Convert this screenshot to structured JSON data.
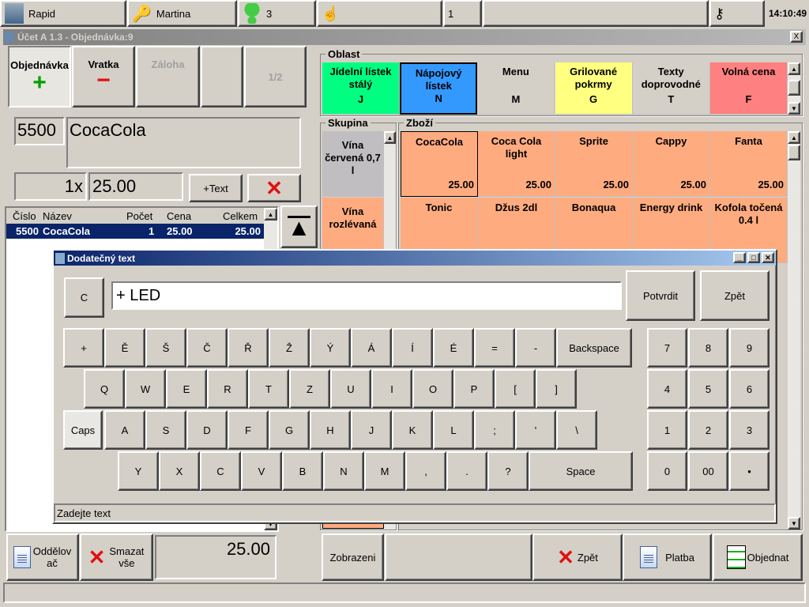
{
  "taskbar": {
    "app": "Rapid",
    "user": "Martina",
    "tables": "3",
    "count": "1",
    "time": "14:10:49"
  },
  "window": {
    "title": "Účet A 1.3 - Objednávka:9",
    "close": "X"
  },
  "mode_buttons": {
    "order": "Objednávka",
    "order_sign": "+",
    "return": "Vratka",
    "return_sign": "−",
    "deposit": "Záloha",
    "page": "1/2"
  },
  "item": {
    "code": "5500",
    "name": "CocaCola",
    "qty": "1x",
    "price": "25.00",
    "add_text": "+Text"
  },
  "order_list": {
    "headers": [
      "Číslo",
      "Název",
      "Počet",
      "Cena",
      "Celkem"
    ],
    "rows": [
      {
        "code": "5500",
        "name": "CocaCola",
        "qty": "1",
        "price": "25.00",
        "total": "25.00"
      }
    ]
  },
  "areas": {
    "label": "Oblast",
    "items": [
      {
        "name": "Jídelní lístek stálý",
        "key": "J",
        "color": "#00ff80"
      },
      {
        "name": "Nápojový lístek",
        "key": "N",
        "color": "#3399ff"
      },
      {
        "name": "Menu",
        "key": "M",
        "color": "#d4d0c8"
      },
      {
        "name": "Grilované pokrmy",
        "key": "G",
        "color": "#ffff80"
      },
      {
        "name": "Texty doprovodné",
        "key": "T",
        "color": "#d4d0c8"
      },
      {
        "name": "Volná cena",
        "key": "F",
        "color": "#ff8080"
      }
    ]
  },
  "groups": {
    "label": "Skupina",
    "items": [
      {
        "name": "Vína červená 0,7 l",
        "color": "#c0bec0"
      },
      {
        "name": "Vína rozlévaná",
        "color": "#ffab80"
      }
    ]
  },
  "goods": {
    "label": "Zboží",
    "items": [
      {
        "name": "CocaCola",
        "price": "25.00"
      },
      {
        "name": "Coca Cola light",
        "price": "25.00"
      },
      {
        "name": "Sprite",
        "price": "25.00"
      },
      {
        "name": "Cappy",
        "price": "25.00"
      },
      {
        "name": "Fanta",
        "price": "25.00"
      },
      {
        "name": "Tonic",
        "price": ""
      },
      {
        "name": "Džus 2dl",
        "price": ""
      },
      {
        "name": "Bonaqua",
        "price": ""
      },
      {
        "name": "Energy drink",
        "price": ""
      },
      {
        "name": "Kofola točená 0.4 l",
        "price": ""
      }
    ]
  },
  "dialog": {
    "title": "Dodatečný text",
    "clear": "C",
    "input_value": "+ LED",
    "confirm": "Potvrdit",
    "back": "Zpět",
    "status": "Zadejte text",
    "rows": [
      [
        "+",
        "Ě",
        "Š",
        "Č",
        "Ř",
        "Ž",
        "Ý",
        "Á",
        "Í",
        "É",
        "=",
        "-",
        "Backspace"
      ],
      [
        "Q",
        "W",
        "E",
        "R",
        "T",
        "Z",
        "U",
        "I",
        "O",
        "P",
        "[",
        "]"
      ],
      [
        "Caps",
        "A",
        "S",
        "D",
        "F",
        "G",
        "H",
        "J",
        "K",
        "L",
        ";",
        "'",
        "\\"
      ],
      [
        "Y",
        "X",
        "C",
        "V",
        "B",
        "N",
        "M",
        ",",
        ".",
        "?",
        "Space"
      ]
    ],
    "numpad": [
      [
        "7",
        "8",
        "9"
      ],
      [
        "4",
        "5",
        "6"
      ],
      [
        "1",
        "2",
        "3"
      ],
      [
        "0",
        "00",
        "•"
      ]
    ]
  },
  "bottom": {
    "separator": "Oddělovač",
    "clear_all": "Smazat vše",
    "total": "25.00",
    "display": "Zobrazeni",
    "back": "Zpět",
    "payment": "Platba",
    "order": "Objednat"
  },
  "colors": {
    "goods_tile": "#ffab80",
    "selection": "#0a246a",
    "accent_green": "#00a000",
    "accent_red": "#e01010"
  }
}
